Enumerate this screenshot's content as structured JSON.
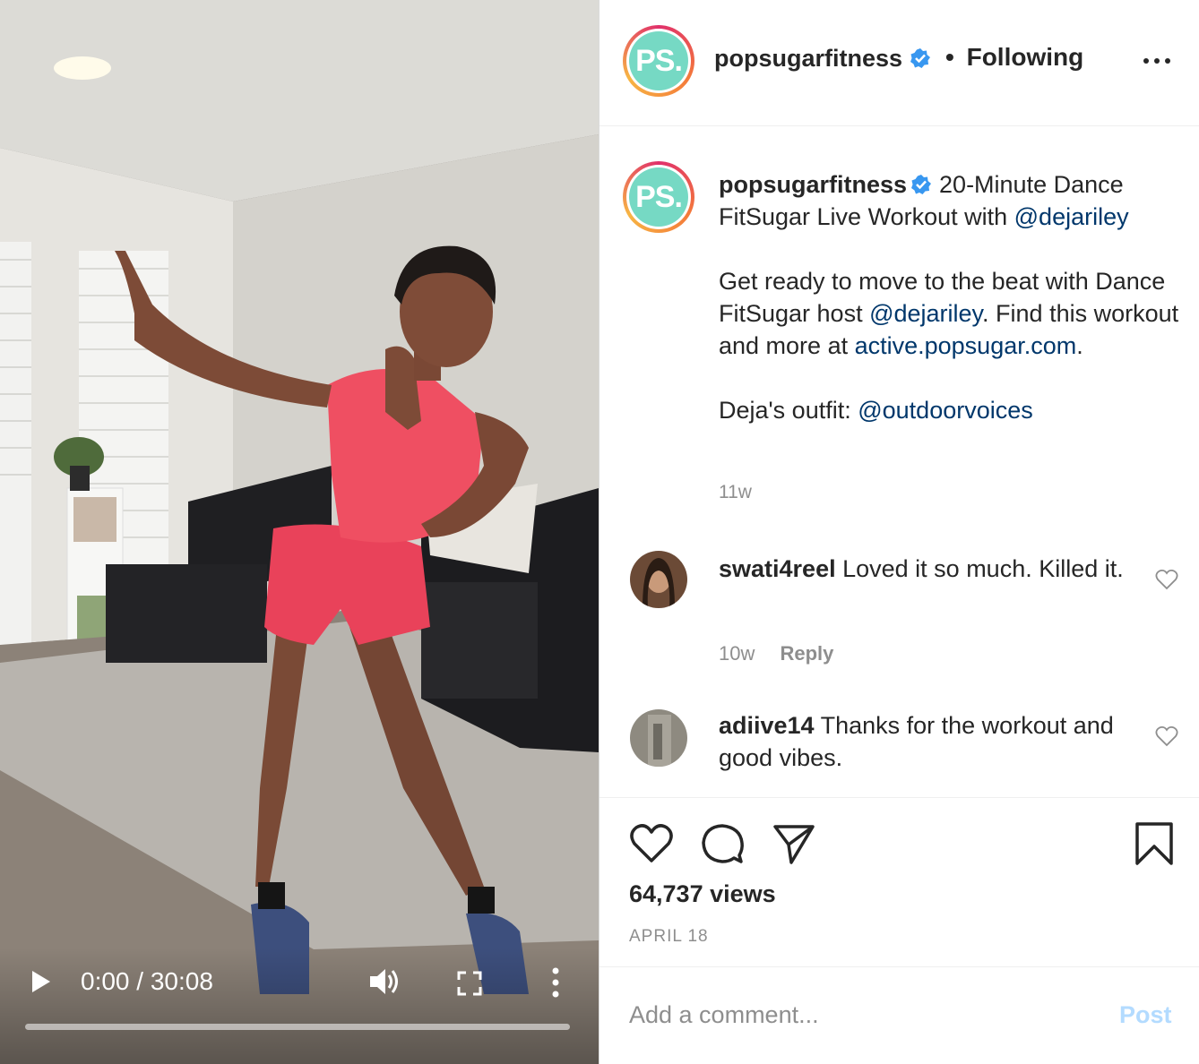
{
  "video": {
    "time_display": "0:00 / 30:08",
    "progress": 0
  },
  "header": {
    "username": "popsugarfitness",
    "separator": "•",
    "follow_state": "Following",
    "avatar_text": "PS."
  },
  "caption": {
    "username": "popsugarfitness",
    "title_text": "20-Minute Dance FitSugar Live Workout with ",
    "title_mention": "@dejariley",
    "para1_a": "Get ready to move to the beat with Dance FitSugar host ",
    "para1_mention": "@dejariley",
    "para1_b": ". Find this workout and more at ",
    "para1_link": "active.popsugar.com",
    "para1_end": ".",
    "para2_a": "Deja's outfit: ",
    "para2_mention": "@outdoorvoices",
    "time": "11w"
  },
  "comments": [
    {
      "username": "swati4reel",
      "text": "Loved it so much. Killed it.",
      "time": "10w",
      "reply": "Reply"
    },
    {
      "username": "adiive14",
      "text": "Thanks for the workout and good vibes."
    }
  ],
  "actions": {
    "views": "64,737 views",
    "date": "APRIL 18"
  },
  "add_comment": {
    "placeholder": "Add a comment...",
    "post_label": "Post"
  },
  "colors": {
    "accent_link": "#00376b",
    "verified_blue": "#3897f0",
    "post_disabled": "#b3dbff",
    "ps_teal": "#76d9c4"
  }
}
